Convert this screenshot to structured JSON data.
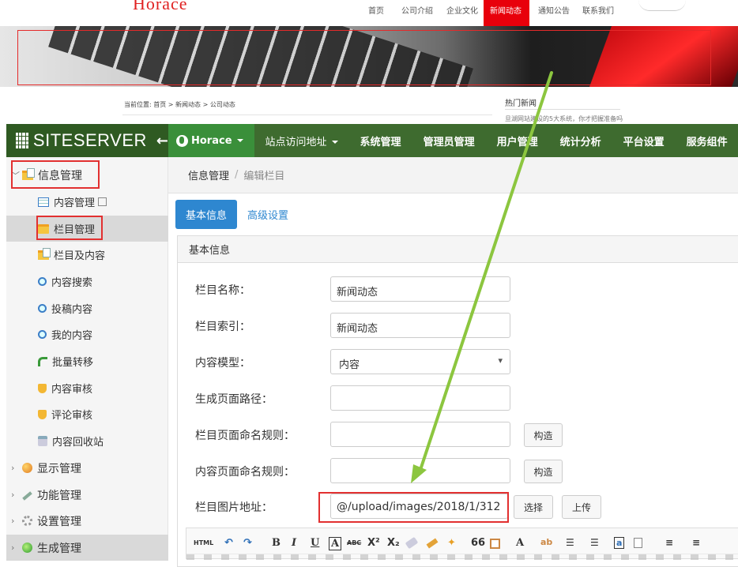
{
  "preview": {
    "logo": "Horace",
    "nav": [
      "首页",
      "公司介绍",
      "企业文化",
      "新闻动态",
      "通知公告",
      "联系我们"
    ],
    "breadcrumb": "当前位置: 首页 > 新闻动态 > 公司动态",
    "hot_news_title": "热门新闻",
    "hot_news_sub": "旦湖网站建设的5大系统，你才把握准备吗"
  },
  "header": {
    "brand": "SITESERVER",
    "site_name": "Horace",
    "menu": [
      "站点访问地址",
      "系统管理",
      "管理员管理",
      "用户管理",
      "统计分析",
      "平台设置",
      "服务组件"
    ]
  },
  "sidebar": {
    "items": [
      {
        "label": "信息管理",
        "level": 1,
        "icon": "folder-doc-icon",
        "chevron": "﹀"
      },
      {
        "label": "内容管理",
        "level": 2,
        "icon": "table-icon"
      },
      {
        "label": "栏目管理",
        "level": 2,
        "icon": "folder-icon"
      },
      {
        "label": "栏目及内容",
        "level": 2,
        "icon": "folder-doc-icon"
      },
      {
        "label": "内容搜索",
        "level": 2,
        "icon": "search-icon"
      },
      {
        "label": "投稿内容",
        "level": 2,
        "icon": "search-icon"
      },
      {
        "label": "我的内容",
        "level": 2,
        "icon": "search-icon"
      },
      {
        "label": "批量转移",
        "level": 2,
        "icon": "arrow-icon"
      },
      {
        "label": "内容审核",
        "level": 2,
        "icon": "shield-icon"
      },
      {
        "label": "评论审核",
        "level": 2,
        "icon": "shield-icon"
      },
      {
        "label": "内容回收站",
        "level": 2,
        "icon": "recycle-icon"
      },
      {
        "label": "显示管理",
        "level": 1,
        "icon": "display-icon",
        "chevron": "›"
      },
      {
        "label": "功能管理",
        "level": 1,
        "icon": "wrench-icon",
        "chevron": "›"
      },
      {
        "label": "设置管理",
        "level": 1,
        "icon": "gear-icon",
        "chevron": "›"
      },
      {
        "label": "生成管理",
        "level": 1,
        "icon": "globe-icon",
        "chevron": "›"
      }
    ]
  },
  "main": {
    "breadcrumb_root": "信息管理",
    "breadcrumb_sep": "/",
    "breadcrumb_current": "编辑栏目",
    "tabs": {
      "basic": "基本信息",
      "advanced": "高级设置"
    },
    "panel_title": "基本信息",
    "fields": {
      "name_label": "栏目名称：",
      "name_value": "新闻动态",
      "index_label": "栏目索引：",
      "index_value": "新闻动态",
      "model_label": "内容模型：",
      "model_value": "内容",
      "path_label": "生成页面路径：",
      "path_value": "",
      "channel_rule_label": "栏目页面命名规则：",
      "channel_rule_value": "",
      "content_rule_label": "内容页面命名规则：",
      "content_rule_value": "",
      "image_label": "栏目图片地址：",
      "image_value": "@/upload/images/2018/1/312"
    },
    "buttons": {
      "build": "构造",
      "choose": "选择",
      "upload": "上传"
    },
    "editor_tools": [
      "HTML",
      "↶",
      "↷",
      "B",
      "I",
      "U",
      "A",
      "ABC",
      "X²",
      "X₂",
      "66",
      "A",
      "a"
    ]
  },
  "colors": {
    "header_bg": "#3e6b2f",
    "accent_blue": "#2e87d0",
    "annotation_red": "#e23030",
    "annotation_arrow": "#8cc63f"
  }
}
